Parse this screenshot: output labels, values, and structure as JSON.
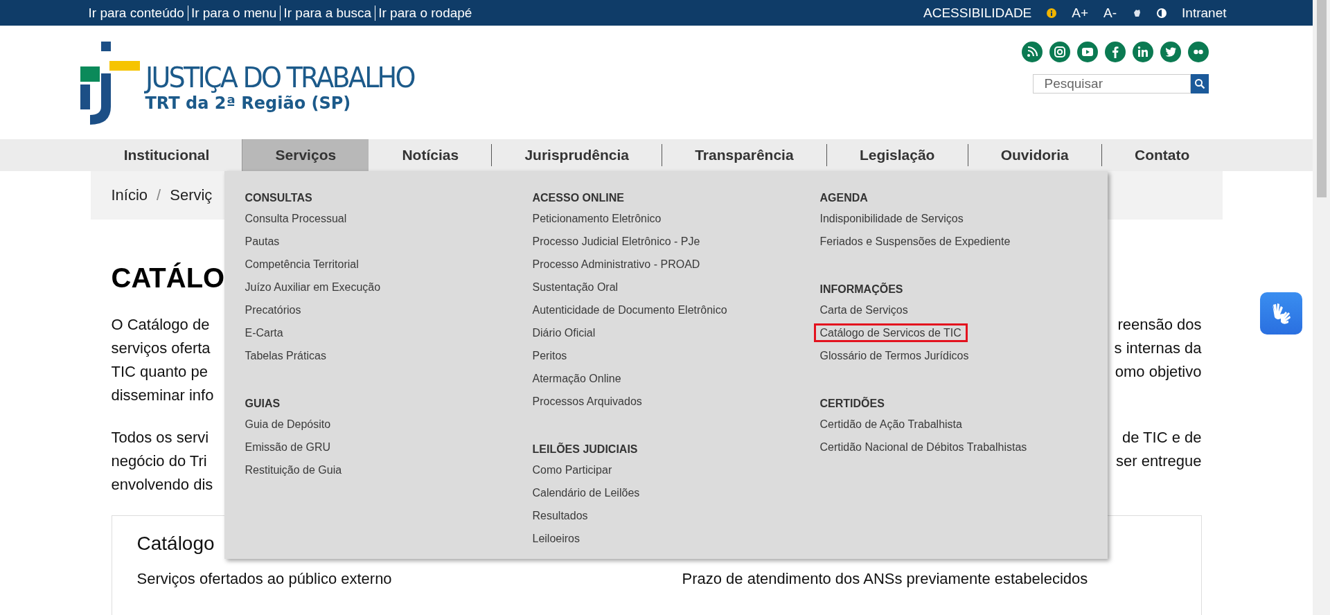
{
  "skip_links": [
    "Ir para conteúdo",
    "Ir para o menu",
    "Ir para a busca",
    "Ir para o rodapé"
  ],
  "accessibility": {
    "label": "ACESSIBILIDADE",
    "increase": "A+",
    "decrease": "A-"
  },
  "intranet": "Intranet",
  "logo": {
    "title": "JUSTIÇA DO TRABALHO",
    "subtitle": "TRT da 2ª Região (SP)"
  },
  "search": {
    "placeholder": "Pesquisar"
  },
  "nav": [
    {
      "label": "Institucional",
      "selected": false
    },
    {
      "label": "Serviços",
      "selected": true
    },
    {
      "label": "Notícias",
      "selected": false
    },
    {
      "label": "Jurisprudência",
      "selected": false
    },
    {
      "label": "Transparência",
      "selected": false
    },
    {
      "label": "Legislação",
      "selected": false
    },
    {
      "label": "Ouvidoria",
      "selected": false
    },
    {
      "label": "Contato",
      "selected": false
    }
  ],
  "breadcrumb": {
    "home": "Início",
    "separator": "/",
    "current": "Serviç"
  },
  "page": {
    "heading": "CATÁLO",
    "paragraphs": [
      [
        {
          "left": "O Catálogo de",
          "right": "reensão dos"
        },
        {
          "left": "serviços oferta",
          "right": "s internas da"
        },
        {
          "left": "TIC quanto pe",
          "right": "omo objetivo"
        },
        {
          "left": "disseminar info"
        }
      ],
      [
        {
          "left": "Todos os servi",
          "right": "de TIC e de"
        },
        {
          "left": "negócio do Tri",
          "right": "ser entregue"
        },
        {
          "left": "envolvendo dis"
        }
      ]
    ],
    "card": {
      "title": "Catálogo",
      "columns": [
        "Serviços ofertados ao público externo",
        "Prazo de atendimento dos ANSs previamente estabelecidos"
      ]
    }
  },
  "dropdown": {
    "columns": [
      [
        {
          "heading": "CONSULTAS",
          "items": [
            {
              "label": "Consulta Processual",
              "highlighted": false
            },
            {
              "label": "Pautas",
              "highlighted": false
            },
            {
              "label": "Competência Territorial",
              "highlighted": false
            },
            {
              "label": "Juízo Auxiliar em Execução",
              "highlighted": false
            },
            {
              "label": "Precatórios",
              "highlighted": false
            },
            {
              "label": "E-Carta",
              "highlighted": false
            },
            {
              "label": "Tabelas Práticas",
              "highlighted": false
            }
          ]
        },
        {
          "heading": "GUIAS",
          "items": [
            {
              "label": "Guia de Depósito",
              "highlighted": false
            },
            {
              "label": "Emissão de GRU",
              "highlighted": false
            },
            {
              "label": "Restituição de Guia",
              "highlighted": false
            }
          ]
        }
      ],
      [
        {
          "heading": "ACESSO ONLINE",
          "items": [
            {
              "label": "Peticionamento Eletrônico",
              "highlighted": false
            },
            {
              "label": "Processo Judicial Eletrônico - PJe",
              "highlighted": false
            },
            {
              "label": "Processo Administrativo - PROAD",
              "highlighted": false
            },
            {
              "label": "Sustentação Oral",
              "highlighted": false
            },
            {
              "label": "Autenticidade de Documento Eletrônico",
              "highlighted": false
            },
            {
              "label": "Diário Oficial",
              "highlighted": false
            },
            {
              "label": "Peritos",
              "highlighted": false
            },
            {
              "label": "Atermação Online",
              "highlighted": false
            },
            {
              "label": "Processos Arquivados",
              "highlighted": false
            }
          ]
        },
        {
          "heading": "LEILÕES JUDICIAIS",
          "items": [
            {
              "label": "Como Participar",
              "highlighted": false
            },
            {
              "label": "Calendário de Leilões",
              "highlighted": false
            },
            {
              "label": "Resultados",
              "highlighted": false
            },
            {
              "label": "Leiloeiros",
              "highlighted": false
            }
          ]
        }
      ],
      [
        {
          "heading": "AGENDA",
          "items": [
            {
              "label": "Indisponibilidade de Serviços",
              "highlighted": false
            },
            {
              "label": "Feriados e Suspensões de Expediente",
              "highlighted": false
            }
          ]
        },
        {
          "heading": "INFORMAÇÕES",
          "items": [
            {
              "label": "Carta de Serviços",
              "highlighted": false
            },
            {
              "label": "Catálogo de Servicos de TIC",
              "highlighted": true
            },
            {
              "label": "Glossário de Termos Jurídicos",
              "highlighted": false
            }
          ]
        },
        {
          "heading": "CERTIDÕES",
          "items": [
            {
              "label": "Certidão de Ação Trabalhista",
              "highlighted": false
            },
            {
              "label": "Certidão Nacional de Débitos Trabalhistas",
              "highlighted": false
            }
          ]
        }
      ]
    ]
  }
}
